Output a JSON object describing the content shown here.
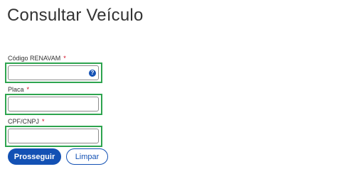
{
  "page": {
    "title": "Consultar Veículo"
  },
  "form": {
    "renavam": {
      "label": "Código RENAVAM",
      "required_mark": "*",
      "value": "",
      "help_icon": "question-icon"
    },
    "placa": {
      "label": "Placa",
      "required_mark": "*",
      "value": ""
    },
    "cpf_cnpj": {
      "label": "CPF/CNPJ",
      "required_mark": "*",
      "value": ""
    }
  },
  "actions": {
    "submit_label": "Prosseguir",
    "clear_label": "Limpar"
  },
  "colors": {
    "primary": "#1351b4",
    "highlight": "#2ea44f",
    "required": "#d0021b"
  }
}
